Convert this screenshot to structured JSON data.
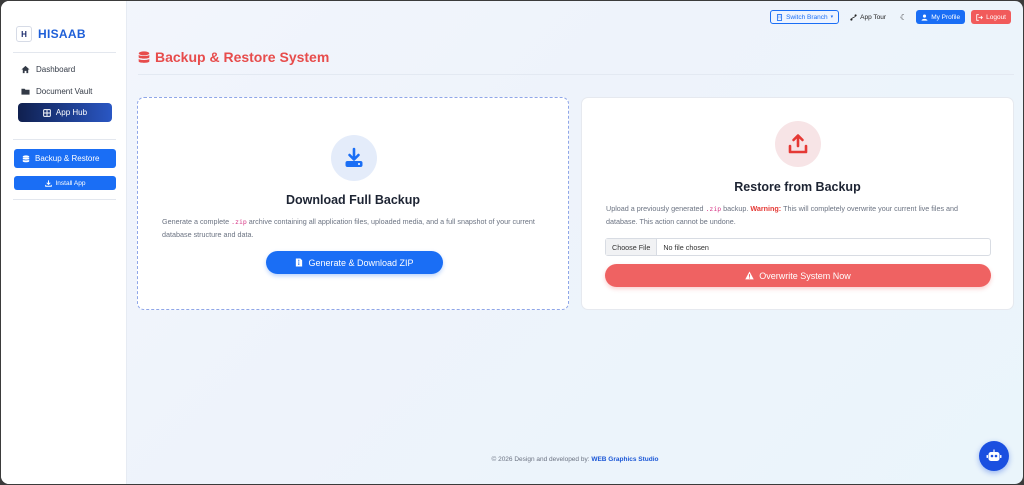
{
  "brand": {
    "name": "HISAAB",
    "logo_text": "H"
  },
  "sidebar": {
    "items": [
      {
        "label": "Dashboard",
        "icon": "home-icon"
      },
      {
        "label": "Document Vault",
        "icon": "folder-icon"
      }
    ],
    "app_hub": {
      "label": "App Hub",
      "icon": "grid-icon"
    },
    "active": {
      "label": "Backup & Restore",
      "icon": "database-icon"
    },
    "install": {
      "label": "Install App",
      "icon": "download-icon"
    }
  },
  "topbar": {
    "switch_branch": "Switch Branch",
    "app_tour": "App Tour",
    "my_profile": "My Profile",
    "logout": "Logout"
  },
  "page": {
    "title": "Backup & Restore System"
  },
  "download_card": {
    "title": "Download Full Backup",
    "desc_before": "Generate a complete ",
    "desc_code": ".zip",
    "desc_after": " archive containing all application files, uploaded media, and a full snapshot of your current database structure and data.",
    "button": "Generate & Download ZIP"
  },
  "restore_card": {
    "title": "Restore from Backup",
    "desc_before": "Upload a previously generated ",
    "desc_code": ".zip",
    "desc_mid": " backup. ",
    "warning": "Warning:",
    "desc_after": " This will completely overwrite your current live files and database. This action cannot be undone.",
    "file_button": "Choose File",
    "file_status": "No file chosen",
    "button": "Overwrite System Now"
  },
  "footer": {
    "text": "© 2026 Design and developed by: ",
    "link": "WEB Graphics Studio"
  },
  "colors": {
    "primary": "#1a6ef5",
    "danger": "#ef6262",
    "title_red": "#e74c4c",
    "brand_blue": "#1e5fd8"
  }
}
